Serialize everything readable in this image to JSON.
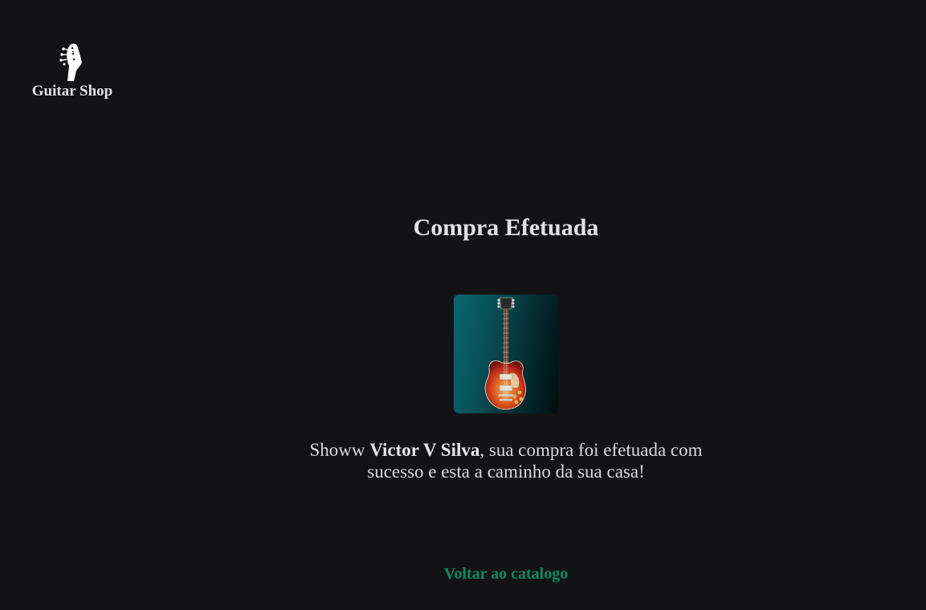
{
  "brand": {
    "name": "Guitar Shop",
    "icon": "guitar-headstock-icon"
  },
  "confirmation": {
    "title": "Compra Efetuada",
    "product_image": "electric-guitar-image",
    "greeting": "Showw",
    "customer_name": "Victor V Silva",
    "message_rest": ", sua compra foi efetuada com sucesso e esta a caminho da sua casa!",
    "back_link_label": "Voltar ao catalogo"
  },
  "colors": {
    "background": "#131315",
    "text": "#e1e1e6",
    "accent_link": "#0d8a5c",
    "product_card_gradient_start": "#0a6670",
    "product_card_gradient_end": "#000f10"
  }
}
